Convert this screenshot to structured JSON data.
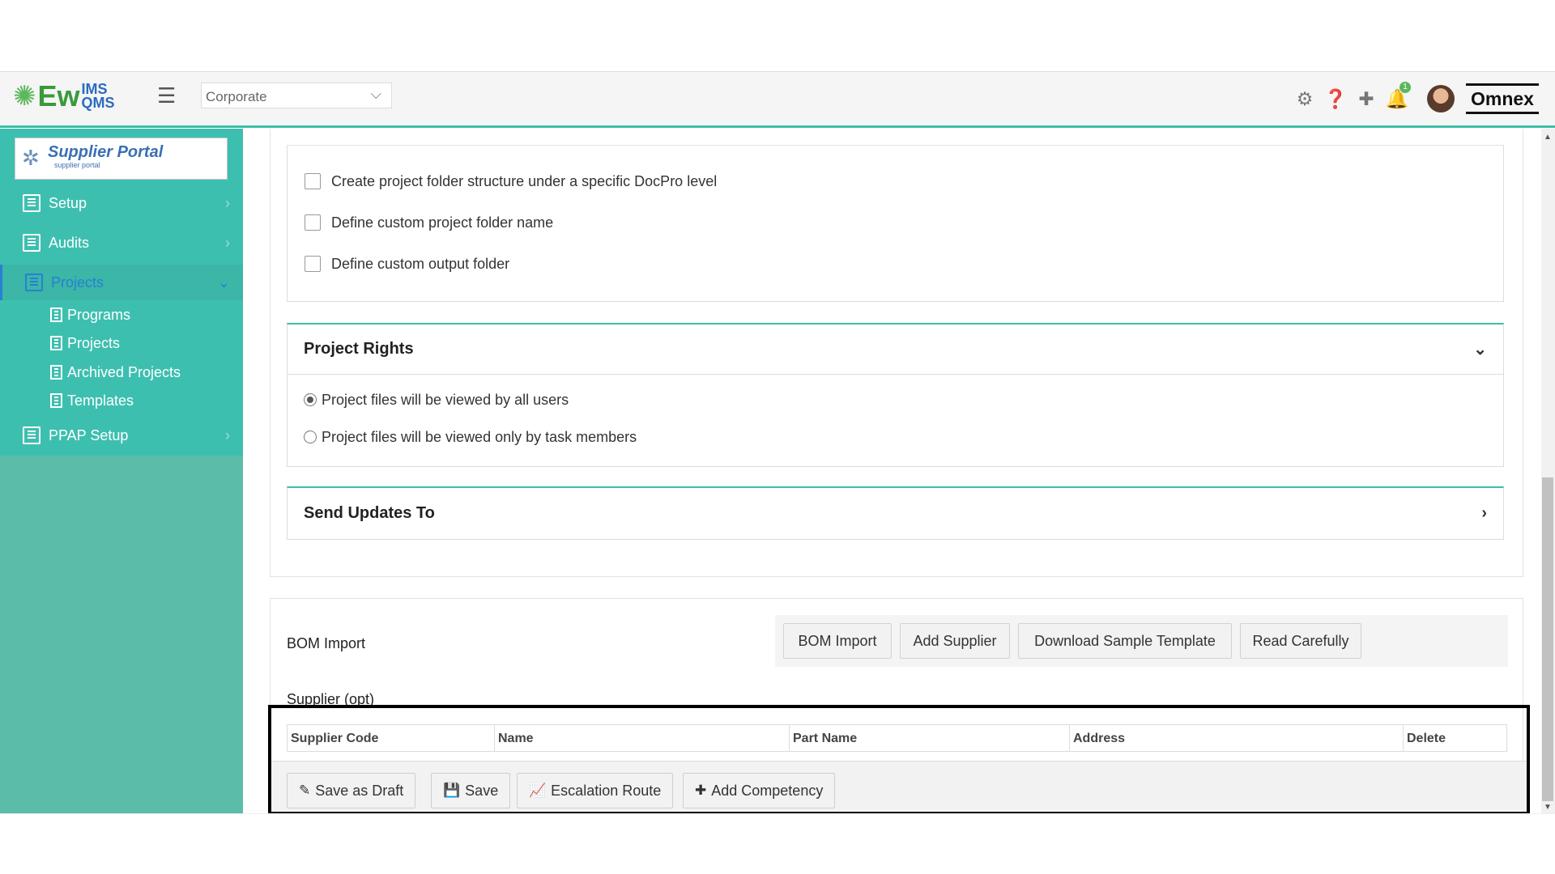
{
  "header": {
    "logo_main": "Ew",
    "logo_top": "IMS",
    "logo_bottom": "QMS",
    "org_select_value": "Corporate",
    "notification_count": "1",
    "brand": "Omnex",
    "accent_color": "#3dbfa9"
  },
  "sidebar": {
    "portal_title": "Supplier Portal",
    "portal_subtitle": "supplier portal",
    "items": [
      {
        "label": "Setup"
      },
      {
        "label": "Audits"
      },
      {
        "label": "Projects"
      },
      {
        "label": "PPAP Setup"
      }
    ],
    "sub_items": [
      {
        "label": "Programs"
      },
      {
        "label": "Projects"
      },
      {
        "label": "Archived Projects"
      },
      {
        "label": "Templates"
      }
    ]
  },
  "folder_options": [
    {
      "label": "Create project folder structure under a specific DocPro level",
      "checked": false
    },
    {
      "label": "Define custom project folder name",
      "checked": false
    },
    {
      "label": "Define custom output folder",
      "checked": false
    }
  ],
  "project_rights": {
    "title": "Project Rights",
    "options": [
      {
        "label": "Project files will be viewed by all users",
        "selected": true
      },
      {
        "label": "Project files will be viewed only by task members",
        "selected": false
      }
    ]
  },
  "send_updates": {
    "title": "Send Updates To"
  },
  "bom": {
    "label": "BOM Import",
    "buttons": [
      "BOM Import",
      "Add Supplier",
      "Download Sample Template",
      "Read Carefully"
    ]
  },
  "supplier": {
    "label": "Supplier (opt)",
    "columns": [
      "Supplier Code",
      "Name",
      "Part Name",
      "Address",
      "Delete"
    ]
  },
  "actions": {
    "save_draft": "Save as Draft",
    "save": "Save",
    "escalation": "Escalation Route",
    "add_competency": "Add Competency"
  }
}
